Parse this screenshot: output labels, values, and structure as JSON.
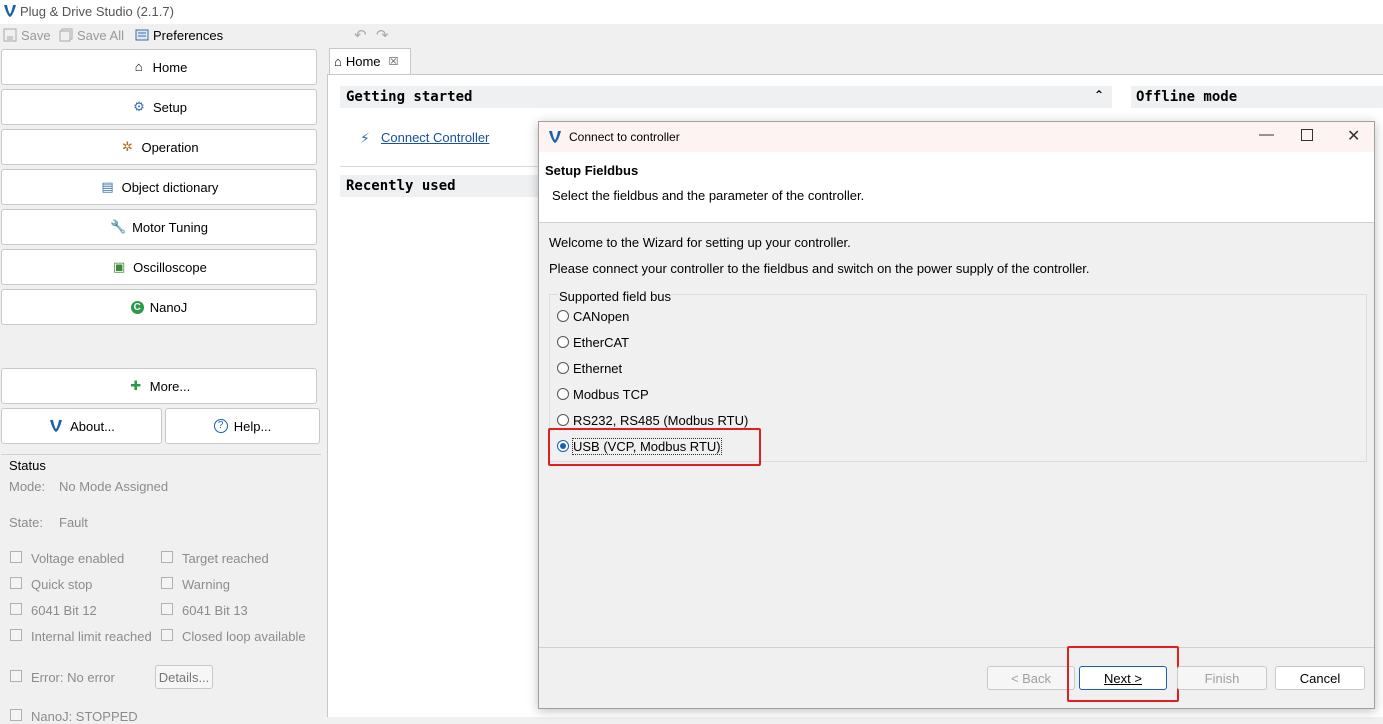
{
  "window": {
    "title": "Plug & Drive Studio (2.1.7)"
  },
  "toolbar": {
    "save": "Save",
    "save_all": "Save All",
    "preferences": "Preferences"
  },
  "nav": {
    "items": [
      "Home",
      "Setup",
      "Operation",
      "Object dictionary",
      "Motor Tuning",
      "Oscilloscope",
      "NanoJ"
    ],
    "more": "More...",
    "about": "About...",
    "help": "Help..."
  },
  "status": {
    "title": "Status",
    "mode_label": "Mode:",
    "mode_value": "No Mode Assigned",
    "state_label": "State:",
    "state_value": "Fault",
    "checks": [
      "Voltage enabled",
      "Target reached",
      "Quick stop",
      "Warning",
      "6041 Bit 12",
      "6041 Bit 13",
      "Internal limit reached",
      "Closed loop available"
    ],
    "error": "Error: No error",
    "details": "Details...",
    "nanoj": "NanoJ: STOPPED"
  },
  "editor": {
    "tab": "Home",
    "getting_started": "Getting started",
    "connect_link": "Connect Controller",
    "recently_used": "Recently used",
    "offline_mode": "Offline mode"
  },
  "dialog": {
    "title": "Connect to controller",
    "header_title": "Setup Fieldbus",
    "header_desc": "Select the fieldbus and the parameter of the controller.",
    "welcome": "Welcome to the Wizard for setting up your controller.",
    "instructions": "Please connect your controller to the fieldbus and switch on the power supply of the controller.",
    "group_label": "Supported field bus",
    "options": [
      "CANopen",
      "EtherCAT",
      "Ethernet",
      "Modbus TCP",
      "RS232, RS485 (Modbus RTU)",
      "USB (VCP, Modbus RTU)"
    ],
    "selected": "USB (VCP, Modbus RTU)",
    "buttons": {
      "back": "< Back",
      "next": "Next >",
      "finish": "Finish",
      "cancel": "Cancel"
    }
  },
  "colors": {
    "highlight": "#e02020",
    "accent": "#1a5fb4",
    "link": "#1a4fa0"
  }
}
